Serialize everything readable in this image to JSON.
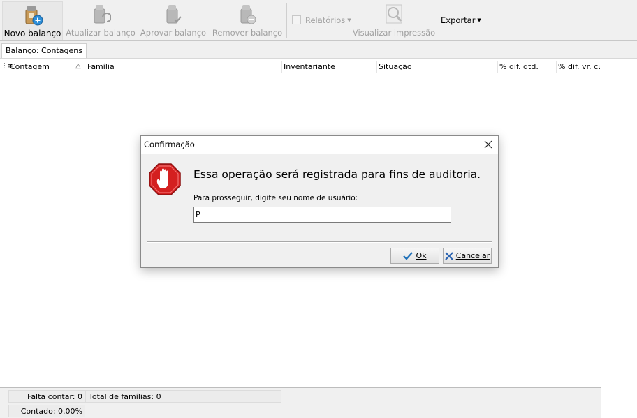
{
  "toolbar": {
    "buttons": [
      {
        "label": "Novo balanço",
        "icon": "new-balance-icon",
        "enabled": true
      },
      {
        "label": "Atualizar balanço",
        "icon": "update-balance-icon",
        "enabled": false
      },
      {
        "label": "Aprovar balanço",
        "icon": "approve-balance-icon",
        "enabled": false
      },
      {
        "label": "Remover balanço",
        "icon": "remove-balance-icon",
        "enabled": false
      }
    ],
    "reports_label": "Relatórios",
    "print_preview_label": "Visualizar impressão",
    "export_label": "Exportar"
  },
  "tabs": [
    {
      "label": "Balanço: Contagens"
    }
  ],
  "grid": {
    "columns": [
      "Contagem",
      "Família",
      "Inventariante",
      "Situação",
      "% dif. qtd.",
      "% dif. vr. cu"
    ],
    "sort_indicator": "△"
  },
  "status": {
    "falta_contar": "Falta contar: 0",
    "total_familias": "Total de famílias: 0",
    "contado": "Contado: 0.00%"
  },
  "dialog": {
    "title": "Confirmação",
    "message": "Essa operação será registrada para fins de auditoria.",
    "prompt": "Para prosseguir, digite seu nome de usuário:",
    "input_value": "P",
    "ok_label": "Ok",
    "cancel_label": "Cancelar"
  },
  "colors": {
    "stop_red": "#d42020",
    "ok_check": "#1c6fb8",
    "cancel_x": "#2a62b0"
  }
}
